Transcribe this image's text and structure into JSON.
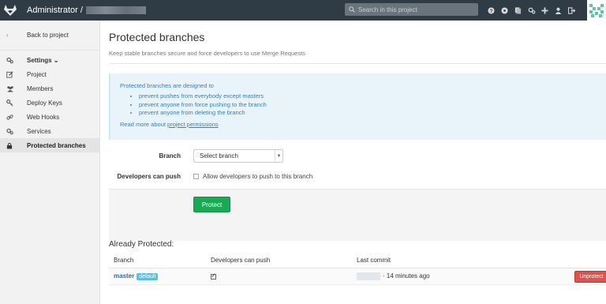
{
  "header": {
    "title": "Administrator /",
    "search_placeholder": "Search in this project",
    "icons": [
      "help-icon",
      "explore-icon",
      "snippets-icon",
      "admin-area-icon",
      "new-project-icon",
      "profile-icon",
      "sign-out-icon"
    ]
  },
  "sidebar": {
    "back_label": "Back to project",
    "settings_label": "Settings ⌄",
    "items": [
      {
        "label": "Project",
        "icon": "edit-icon"
      },
      {
        "label": "Members",
        "icon": "users-icon"
      },
      {
        "label": "Deploy Keys",
        "icon": "key-icon"
      },
      {
        "label": "Web Hooks",
        "icon": "link-icon"
      },
      {
        "label": "Services",
        "icon": "cogs-icon"
      },
      {
        "label": "Protected branches",
        "icon": "lock-icon",
        "active": true
      }
    ]
  },
  "main": {
    "title": "Protected branches",
    "description": "Keep stable branches secure and force developers to use Merge Requests",
    "info": {
      "intro": "Protected branches are designed to",
      "bullets": [
        "prevent pushes from everybody except masters",
        "prevent anyone from force pushing to the branch",
        "prevent anyone from deleting the branch"
      ],
      "read_more": "Read more about",
      "read_more_link": "project permissions"
    },
    "form": {
      "branch_label": "Branch",
      "branch_select": "Select branch",
      "dev_push_label": "Developers can push",
      "dev_push_checkbox_label": "Allow developers to push to this branch",
      "dev_push_checked": false,
      "protect_button": "Protect"
    },
    "protected": {
      "heading": "Already Protected:",
      "columns": [
        "Branch",
        "Developers can push",
        "Last commit"
      ],
      "rows": [
        {
          "branch": "master",
          "badge": "default",
          "developers_can_push": true,
          "last_commit": "· 14 minutes ago",
          "action": "Unprotect"
        }
      ]
    }
  },
  "colors": {
    "header_bg": "#2f3b45",
    "protect_button": "#1aaa55",
    "unprotect_button": "#d9534f",
    "info_bg": "#e9f4fa",
    "info_text": "#3a7fb0"
  }
}
